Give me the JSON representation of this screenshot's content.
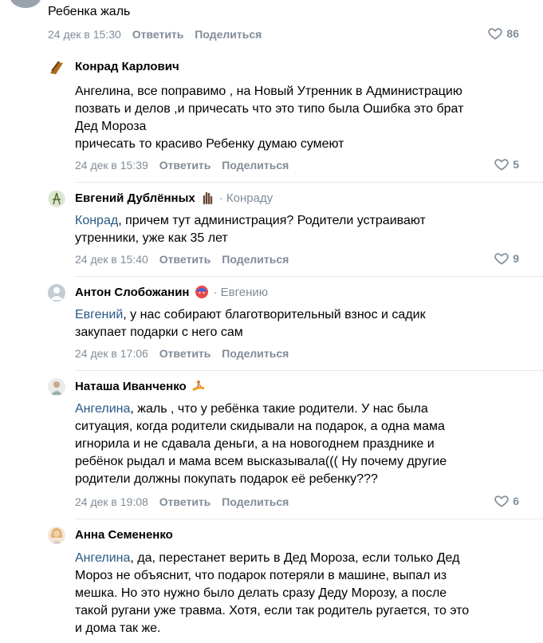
{
  "top": {
    "text": "Ребенка жаль",
    "time": "24 дек в 15:30",
    "reply": "Ответить",
    "share": "Поделиться",
    "likes": "86"
  },
  "comments": [
    {
      "name": "Конрад Карлович",
      "reply_to": "",
      "lines": [
        "Ангелина, все поправимо , на Новый Утренник в Администрацию",
        "позвать и делов ,и причесать что это типо была Ошибка это брат",
        "Дед Мороза",
        "причесать то красиво Ребенку думаю сумеют"
      ],
      "time": "24 дек в 15:39",
      "reply": "Ответить",
      "share": "Поделиться",
      "likes": "5"
    },
    {
      "name": "Евгений Дублённых",
      "reply_to": "Конраду",
      "mention": "Конрад",
      "lines": [
        ", причем тут администрация? Родители устраивают",
        "утренники, уже как 35 лет"
      ],
      "time": "24 дек в 15:40",
      "reply": "Ответить",
      "share": "Поделиться",
      "likes": "9"
    },
    {
      "name": "Антон Слобожанин",
      "reply_to": "Евгению",
      "mention": "Евгений",
      "lines": [
        ", у нас собирают благотворительный взнос и садик",
        "закупает подарки с него сам"
      ],
      "time": "24 дек в 17:06",
      "reply": "Ответить",
      "share": "Поделиться",
      "likes": ""
    },
    {
      "name": "Наташа Иванченко",
      "reply_to": "",
      "mention": "Ангелина",
      "lines": [
        ", жаль , что у ребёнка такие родители. У нас была",
        "ситуация, когда родители скидывали на подарок, а одна мама",
        "игнорила и не сдавала деньги, а на новогоднем празднике и",
        "ребёнок рыдал и мама всем высказывала((( Ну почему другие",
        "родители должны покупать подарок её ребенку???"
      ],
      "time": "24 дек в 19:08",
      "reply": "Ответить",
      "share": "Поделиться",
      "likes": "6"
    },
    {
      "name": "Анна Семененко",
      "reply_to": "",
      "mention": "Ангелина",
      "lines": [
        ", да, перестанет верить в Дед Мороза, если только Дед",
        "Мороз не объяснит, что подарок потеряли в машине, выпал из",
        "мешка. Но это нужно было делать сразу Деду Морозу, а после",
        "такой ругани уже травма. Хотя, если так родитель ругается, то это",
        "и дома так же."
      ]
    }
  ],
  "colors": {
    "meta": "#818c99",
    "link": "#2a5885",
    "divider": "#e7e8ec"
  },
  "icons": {
    "like": "heart-outline-icon"
  }
}
